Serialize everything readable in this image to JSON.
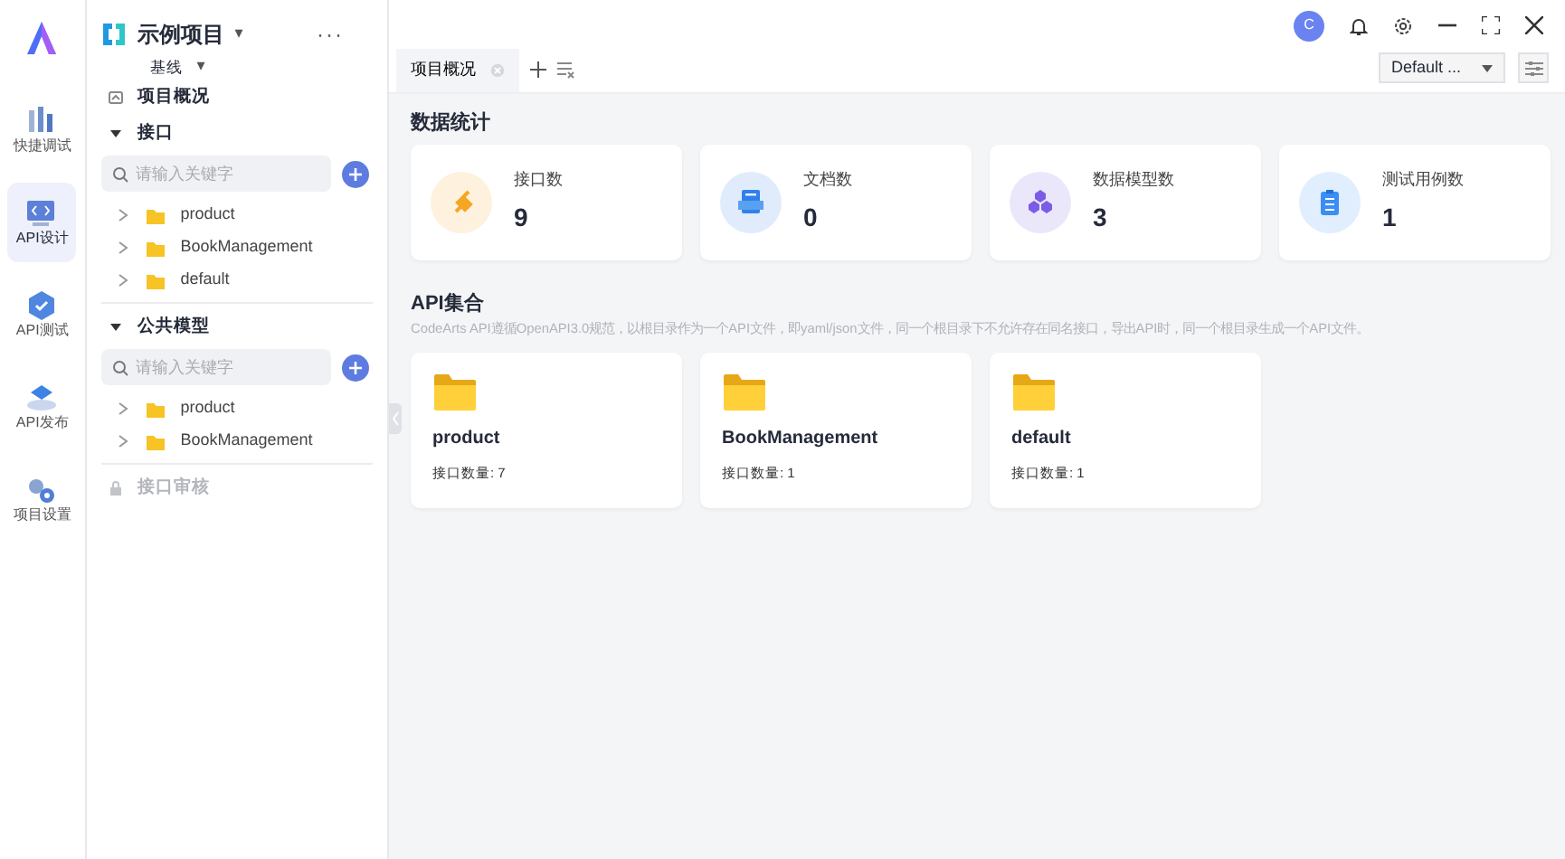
{
  "rail": {
    "items": [
      {
        "label": "快捷调试",
        "selected": false
      },
      {
        "label": "API设计",
        "selected": true
      },
      {
        "label": "API测试",
        "selected": false
      },
      {
        "label": "API发布",
        "selected": false
      },
      {
        "label": "项目设置",
        "selected": false
      }
    ]
  },
  "sidebar": {
    "project": {
      "name": "示例项目",
      "caret": "▾",
      "menu": "···"
    },
    "branch": {
      "name": "基线",
      "caret": "▾"
    },
    "sections": [
      {
        "kind": "link",
        "label": "项目概况",
        "disabled": false
      },
      {
        "kind": "tree",
        "label": "接口",
        "expanded": true,
        "search_placeholder": "请输入关键字",
        "items": [
          {
            "label": "product",
            "expanded": false
          },
          {
            "label": "BookManagement",
            "expanded": false
          },
          {
            "label": "default",
            "expanded": false
          }
        ]
      },
      {
        "kind": "tree",
        "label": "公共模型",
        "expanded": true,
        "search_placeholder": "请输入关键字",
        "items": [
          {
            "label": "product",
            "expanded": false
          },
          {
            "label": "BookManagement",
            "expanded": false
          }
        ]
      },
      {
        "kind": "locked",
        "label": "接口审核",
        "disabled": true
      }
    ]
  },
  "topbar": {
    "avatar": "C"
  },
  "tabs": [
    {
      "label": "项目概况",
      "selected": true
    }
  ],
  "environment": {
    "value": "Default ..."
  },
  "stats": {
    "title": "数据统计",
    "cards": [
      {
        "label": "接口数",
        "value": "9",
        "color": "#f5a623"
      },
      {
        "label": "文档数",
        "value": "0",
        "color": "#2f80ed"
      },
      {
        "label": "数据模型数",
        "value": "3",
        "color": "#7b5ce6"
      },
      {
        "label": "测试用例数",
        "value": "1",
        "color": "#3a8ef6"
      }
    ]
  },
  "collections": {
    "title": "API集合",
    "description": "CodeArts API遵循OpenAPI3.0规范，以根目录作为一个API文件，即yaml/json文件，同一个根目录下不允许存在同名接口，导出API时，同一个根目录生成一个API文件。",
    "cards": [
      {
        "name": "product",
        "count": "接口数量: 7"
      },
      {
        "name": "BookManagement",
        "count": "接口数量: 1"
      },
      {
        "name": "default",
        "count": "接口数量: 1"
      }
    ]
  }
}
